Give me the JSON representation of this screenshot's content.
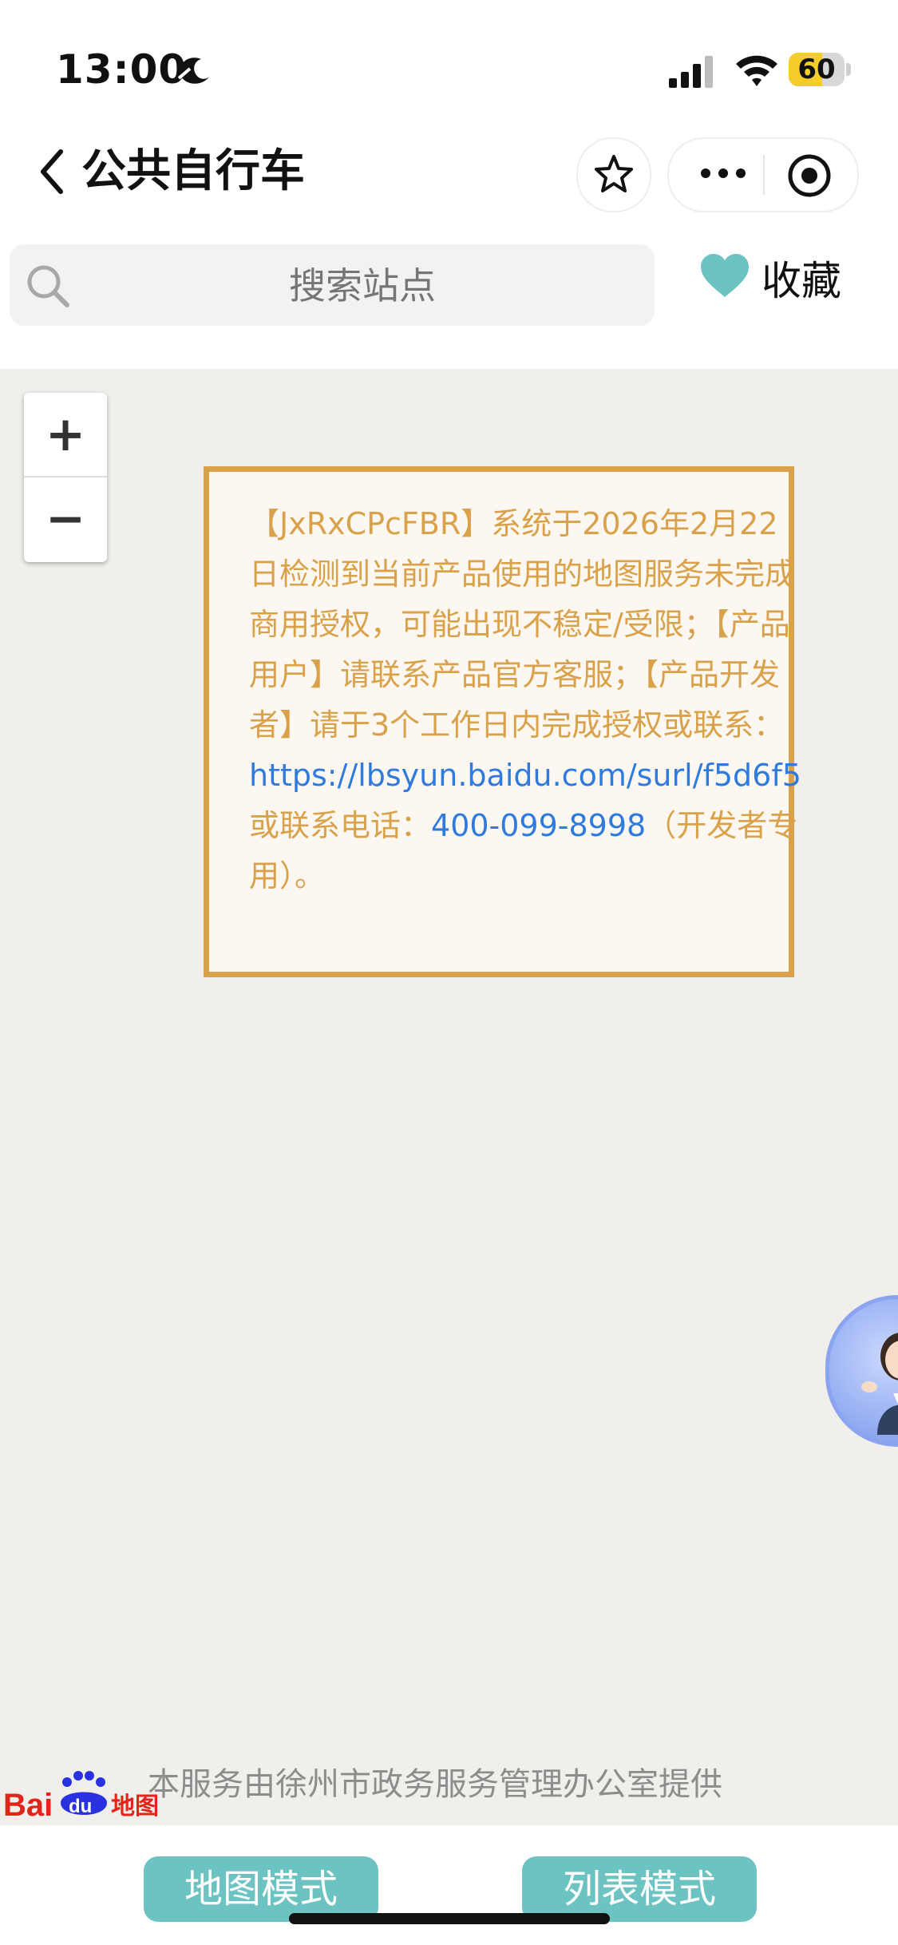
{
  "status_bar": {
    "time": "13:00",
    "battery_level": "60",
    "battery_fraction": 0.6,
    "icons": [
      "moon-focus-icon",
      "signal-icon",
      "wifi-icon",
      "battery-icon"
    ]
  },
  "nav": {
    "title": "公共自行车",
    "icons": [
      "back-chevron-icon",
      "star-icon",
      "more-dots-icon",
      "target-icon"
    ]
  },
  "search": {
    "placeholder": "搜索站点"
  },
  "favorites": {
    "label": "收藏",
    "icon": "heart-icon"
  },
  "map": {
    "zoom_in": "+",
    "zoom_out": "−",
    "notice": {
      "text_before": "【JxRxCPcFBR】系统于2026年2月22日检测到当前产品使用的地图服务未完成商用授权，可能出现不稳定/受限；【产品用户】请联系产品官方客服；【产品开发者】请于3个工作日内完成授权或联系：",
      "link": "https://lbsyun.baidu.com/surl/f5d6f5",
      "text_phone_prefix": "或联系电话：",
      "phone": "400-099-8998",
      "text_after": "（开发者专用）。"
    },
    "credit": "本服务由徐州市政务服务管理办公室提供",
    "logo_text": "Bai du 地图"
  },
  "bottom": {
    "map_mode": "地图模式",
    "list_mode": "列表模式"
  },
  "colors": {
    "accent_teal": "#6cc3c2",
    "notice_border": "#d9a24a",
    "link_blue": "#2f7bdd",
    "map_bg": "#f0efeb",
    "battery_yellow": "#f4cc2b"
  }
}
